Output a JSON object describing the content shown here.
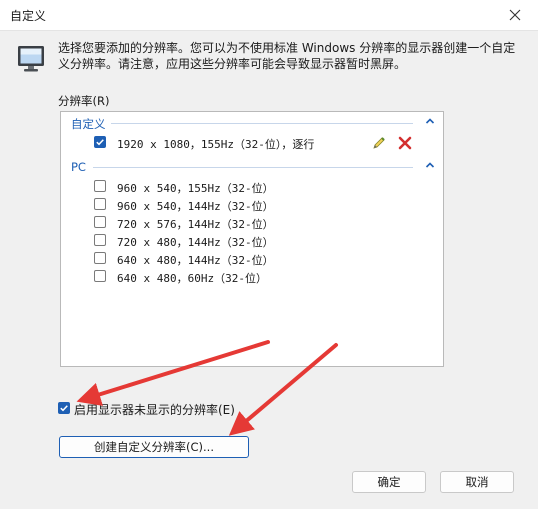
{
  "window": {
    "title": "自定义"
  },
  "description": "选择您要添加的分辨率。您可以为不使用标准 Windows 分辨率的显示器创建一个自定义分辨率。请注意，应用这些分辨率可能会导致显示器暂时黑屏。",
  "list_label": "分辨率(R)",
  "groups": {
    "custom": {
      "name": "自定义",
      "items": [
        {
          "label": "1920 x 1080，155Hz（32-位），逐行",
          "checked": true
        }
      ]
    },
    "pc": {
      "name": "PC",
      "items": [
        {
          "label": "960 x 540，155Hz（32-位）",
          "checked": false
        },
        {
          "label": "960 x 540，144Hz（32-位）",
          "checked": false
        },
        {
          "label": "720 x 576，144Hz（32-位）",
          "checked": false
        },
        {
          "label": "720 x 480，144Hz（32-位）",
          "checked": false
        },
        {
          "label": "640 x 480，144Hz（32-位）",
          "checked": false
        },
        {
          "label": "640 x 480，60Hz（32-位）",
          "checked": false
        }
      ]
    }
  },
  "enable_unexposed": {
    "label": "启用显示器未显示的分辨率(E)",
    "checked": true
  },
  "buttons": {
    "create": "创建自定义分辨率(C)...",
    "ok": "确定",
    "cancel": "取消"
  },
  "colors": {
    "accent": "#1e5fb4",
    "annotation_arrow": "#e53935",
    "delete": "#d32f2f"
  },
  "icons": [
    "monitor-icon",
    "close-icon",
    "chevron-up-icon",
    "pencil-icon",
    "delete-icon",
    "checkmark-icon"
  ]
}
